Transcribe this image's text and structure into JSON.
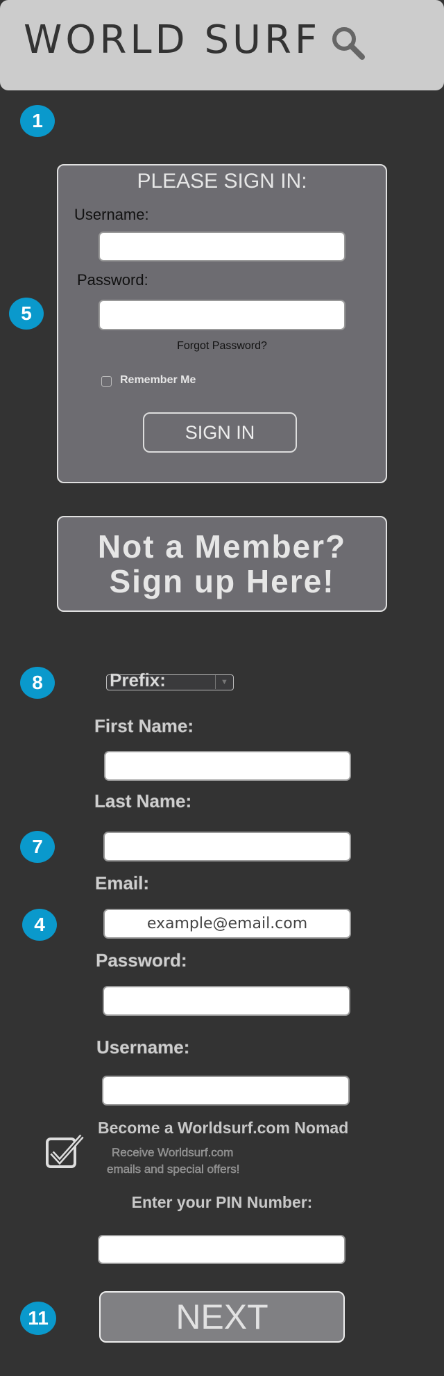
{
  "header": {
    "title": "WORLD SURF",
    "search_icon": "search-icon"
  },
  "badges": {
    "b1": "1",
    "b5": "5",
    "b8": "8",
    "b7": "7",
    "b4": "4",
    "b11": "11"
  },
  "colors": {
    "badge": "#0a99cc",
    "background": "#333333",
    "header": "#cccccc",
    "panel": "#6d6c71"
  },
  "signin": {
    "heading": "PLEASE SIGN IN:",
    "username_label": "Username:",
    "username_value": "",
    "password_label": "Password:",
    "password_value": "",
    "forgot": "Forgot Password?",
    "remember": "Remember Me",
    "remember_checked": false,
    "button": "SIGN IN"
  },
  "signup_banner": {
    "line1": "Not a Member?",
    "line2": "Sign up Here!"
  },
  "register": {
    "prefix_label": "Prefix:",
    "first_name_label": "First Name:",
    "last_name_label": "Last Name:",
    "email_label": "Email:",
    "email_value": "example@email.com",
    "password_label": "Password:",
    "username_label": "Username:",
    "nomad_title": "Become a Worldsurf.com Nomad",
    "nomad_line1": "Receive Worldsurf.com",
    "nomad_line2": "emails and special offers!",
    "nomad_checked": true,
    "pin_label": "Enter your PIN Number:",
    "next_button": "NEXT"
  }
}
